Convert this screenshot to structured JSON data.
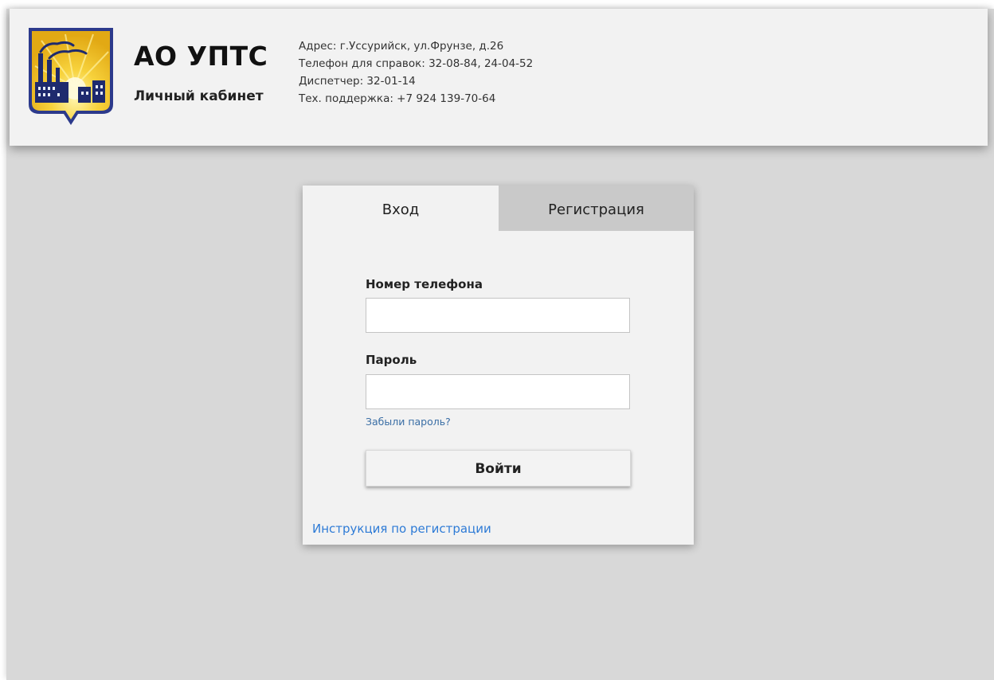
{
  "header": {
    "brand_title": "АО УПТС",
    "brand_subtitle": "Личный кабинет",
    "contacts": {
      "address": "Адрес: г.Уссурийск, ул.Фрунзе, д.26",
      "phone": "Телефон для справок: 32-08-84, 24-04-52",
      "dispatcher": "Диспетчер: 32-01-14",
      "support": "Тех. поддержка: +7 924 139-70-64"
    },
    "logo_icon": "coat-of-arms-icon"
  },
  "auth": {
    "tabs": {
      "login": "Вход",
      "register": "Регистрация",
      "active": "login"
    },
    "phone_label": "Номер телефона",
    "phone_value": "",
    "password_label": "Пароль",
    "password_value": "",
    "forgot_link": "Забыли пароль?",
    "submit_label": "Войти",
    "instruction_link": "Инструкция по регистрации"
  },
  "colors": {
    "page_background": "#d8d8d8",
    "panel_background": "#f2f2f2",
    "inactive_tab": "#c9c9c9",
    "link": "#2e7bd6",
    "shield_border": "#2c3a8c",
    "shield_gold": "#f5c518"
  }
}
